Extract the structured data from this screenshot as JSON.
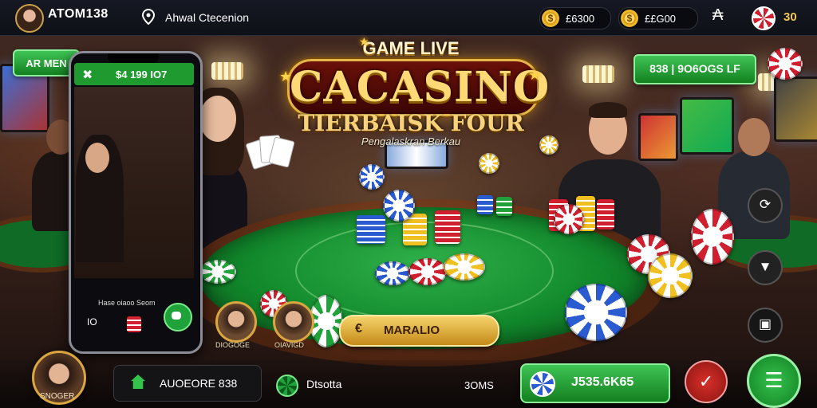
{
  "topbar": {
    "brand": "ATOM138",
    "brand_sub": "",
    "location_label": "Ahwal Ctecenion",
    "coins_1": "£6300",
    "coins_2": "££G00",
    "badge_value": "30"
  },
  "logo": {
    "top_text": "GAME LIVE",
    "main_text": "CACASINO",
    "sub_text": "TIERBAISK FOUR",
    "tagline": "Pengalaskran Berkau"
  },
  "left_banner": "AR MEN",
  "right_banner": "838 | 9O6OGS LF",
  "phone": {
    "header_amount": "$4 199   IO7",
    "caption": "Hase oiaoo Seom",
    "footer_value": "IO"
  },
  "players": [
    {
      "name": "DIOGOGE"
    },
    {
      "name": "OIAVIGD"
    }
  ],
  "action_button": "MARALIO",
  "bottom": {
    "profile_name": "SNOGER",
    "left_pill_value": "AUOEORE 838",
    "mid_label": "Dtsotta",
    "mid_value": "3OMS",
    "balance": "J535.6K65"
  },
  "colors": {
    "accent_green": "#1f9a2f",
    "gold": "#e4b64a",
    "felt": "#128a2c"
  }
}
